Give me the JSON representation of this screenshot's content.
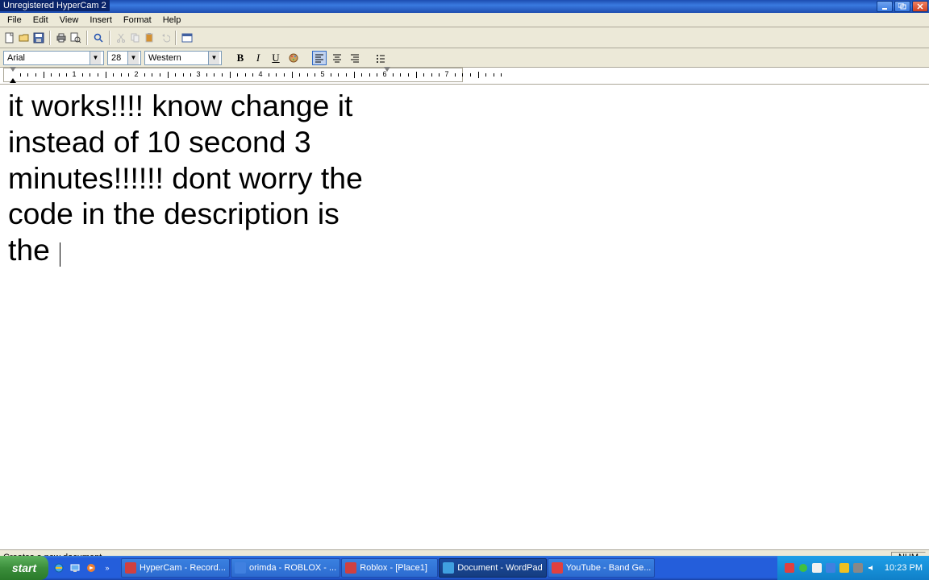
{
  "overlay": {
    "title": "Unregistered HyperCam 2"
  },
  "menubar": {
    "file": "File",
    "edit": "Edit",
    "view": "View",
    "insert": "Insert",
    "format": "Format",
    "help": "Help"
  },
  "formatbar": {
    "font_name": "Arial",
    "font_size": "28",
    "script": "Western"
  },
  "ruler": {
    "marks": [
      "1",
      "2",
      "3",
      "4",
      "5",
      "6",
      "7"
    ]
  },
  "document": {
    "text": "it works!!!! know change it instead of 10 second 3 minutes!!!!!! dont worry the code in the description is the "
  },
  "statusbar": {
    "hint": "Creates a new document.",
    "num": "NUM"
  },
  "taskbar": {
    "start": "start",
    "items": [
      {
        "label": "HyperCam - Record..."
      },
      {
        "label": "orimda - ROBLOX - ..."
      },
      {
        "label": "Roblox - [Place1]"
      },
      {
        "label": "Document - WordPad"
      },
      {
        "label": "YouTube - Band Ge..."
      }
    ],
    "clock": "10:23 PM"
  }
}
